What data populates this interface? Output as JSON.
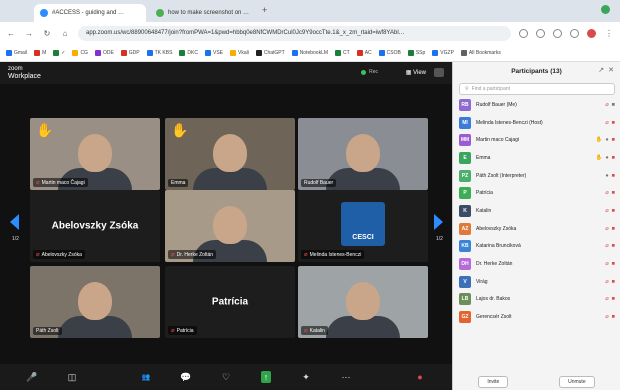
{
  "browser": {
    "tabs": [
      {
        "label": "#ACCESS - guiding and …",
        "favicon_color": "#2d8cff",
        "active": true
      },
      {
        "label": "how to make screenshot on …",
        "favicon_color": "#4caf50",
        "active": false
      }
    ],
    "url": "app.zoom.us/wc/88900648477/join?fromPWA=1&pwd=hbbq0e8NfCWMDrCul0Jc9Y9occTte.1&_x_zm_rtaid=iwf8YAbl…",
    "bookmarks": [
      "Gmail",
      "M",
      "✓",
      "CG",
      "ODE",
      "GDP",
      "TK KBS",
      "DKC",
      "VSE",
      "Vkali",
      "ChatGPT",
      "NotebookLM",
      "CT",
      "AC",
      "CSOB",
      "SSp",
      "VGZP",
      "All Bookmarks"
    ]
  },
  "zoom": {
    "brand_top": "zoom",
    "brand_bottom": "Workplace",
    "status": "Rec",
    "view_label": "View",
    "pager": {
      "left": "1/2",
      "right": "1/2"
    }
  },
  "tiles": [
    {
      "name": "Martin maco Čajagi",
      "muted": true,
      "hand": true,
      "kind": "video",
      "bg": "#9a8f85"
    },
    {
      "name": "Emma",
      "muted": false,
      "hand": true,
      "kind": "video",
      "bg": "#6e6458"
    },
    {
      "name": "Rudolf Bauer",
      "muted": false,
      "hand": false,
      "kind": "video",
      "bg": "#8a8e94"
    },
    {
      "name": "Abelovszky Zsóka",
      "muted": true,
      "hand": false,
      "kind": "name",
      "bg": "#1d1d1d"
    },
    {
      "name": "Dr. Herke Zoltán",
      "muted": true,
      "hand": false,
      "kind": "video",
      "bg": "#a89a88"
    },
    {
      "name": "Melinda Istenes-Benczi",
      "muted": true,
      "hand": false,
      "kind": "logo",
      "bg": "#1d1d1d"
    },
    {
      "name": "Páth Zsolt",
      "muted": false,
      "hand": false,
      "kind": "video",
      "bg": "#7c7468"
    },
    {
      "name": "Patrícia",
      "muted": true,
      "hand": false,
      "kind": "name",
      "bg": "#1d1d1d"
    },
    {
      "name": "Katalin",
      "muted": true,
      "hand": false,
      "kind": "video",
      "bg": "#9ea4a6"
    }
  ],
  "logo_text": "CESCI",
  "participants_panel": {
    "title": "Participants (13)",
    "search_placeholder": "Find a participant",
    "list": [
      {
        "initials": "RB",
        "name": "Rudolf Bauer (Me)",
        "color": "#8e6bd0",
        "hand": false,
        "muted": true,
        "cam_off": false
      },
      {
        "initials": "MI",
        "name": "Melinda Istenes-Benczi (Host)",
        "color": "#3c7bd8",
        "hand": false,
        "muted": true,
        "cam_off": true
      },
      {
        "initials": "MM",
        "name": "Martin maco Čajagi",
        "color": "#9b5cd1",
        "hand": true,
        "muted": false,
        "cam_off": true
      },
      {
        "initials": "E",
        "name": "Emma",
        "color": "#3aa55c",
        "hand": true,
        "muted": false,
        "cam_off": true
      },
      {
        "initials": "PZ",
        "name": "Páth Zsolt (Interpreter)",
        "color": "#4cae6b",
        "hand": false,
        "muted": false,
        "cam_off": true
      },
      {
        "initials": "P",
        "name": "Patrícia",
        "color": "#3dae54",
        "hand": false,
        "muted": true,
        "cam_off": true
      },
      {
        "initials": "K",
        "name": "Katalin",
        "color": "#3b4c66",
        "hand": false,
        "muted": true,
        "cam_off": true
      },
      {
        "initials": "AZ",
        "name": "Abelovszky Zsóka",
        "color": "#e07a3a",
        "hand": false,
        "muted": true,
        "cam_off": true
      },
      {
        "initials": "KB",
        "name": "Katarina Brunciková",
        "color": "#3a84d6",
        "hand": false,
        "muted": true,
        "cam_off": true
      },
      {
        "initials": "DH",
        "name": "Dr. Herke Zoltán",
        "color": "#b66bd8",
        "hand": false,
        "muted": true,
        "cam_off": true
      },
      {
        "initials": "V",
        "name": "Virág",
        "color": "#3c6fb8",
        "hand": false,
        "muted": true,
        "cam_off": true
      },
      {
        "initials": "LB",
        "name": "Lajos dr. Bakos",
        "color": "#6c8f5a",
        "hand": false,
        "muted": true,
        "cam_off": true
      },
      {
        "initials": "GZ",
        "name": "Gerencsér Zsolt",
        "color": "#e2642f",
        "hand": false,
        "muted": true,
        "cam_off": true
      }
    ],
    "invite_label": "Invite",
    "mute_all_label": "Unmute"
  },
  "toolbar": [
    "mic",
    "camera",
    "participants",
    "chat",
    "react",
    "share",
    "apps",
    "more",
    "leave"
  ]
}
